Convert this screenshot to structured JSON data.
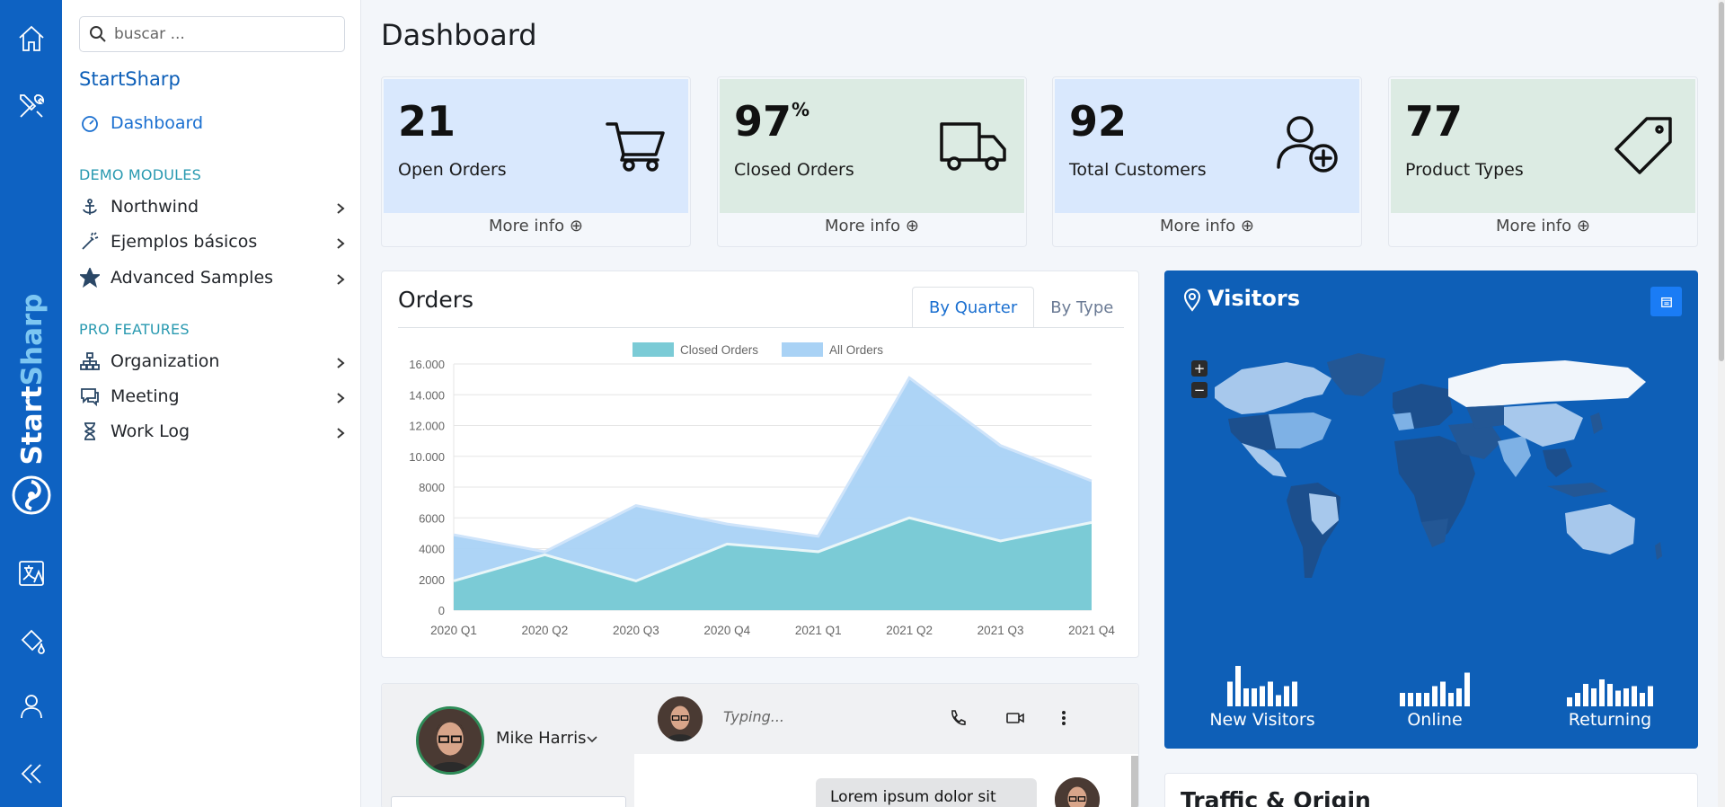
{
  "rail": {
    "items": [
      "home-icon",
      "tools-icon",
      "translate-icon",
      "paint-bucket-icon",
      "user-icon",
      "collapse-icon"
    ],
    "brand_start": "Start",
    "brand_sharp": "Sharp"
  },
  "sidebar": {
    "search_placeholder": "buscar ...",
    "title": "StartSharp",
    "dashboard": "Dashboard",
    "sections": {
      "demo": "DEMO MODULES",
      "pro": "PRO FEATURES"
    },
    "demo_items": [
      {
        "label": "Northwind",
        "icon": "anchor-icon"
      },
      {
        "label": "Ejemplos básicos",
        "icon": "magic-wand-icon"
      },
      {
        "label": "Advanced Samples",
        "icon": "star-icon"
      }
    ],
    "pro_items": [
      {
        "label": "Organization",
        "icon": "org-chart-icon"
      },
      {
        "label": "Meeting",
        "icon": "chat-icon"
      },
      {
        "label": "Work Log",
        "icon": "hourglass-icon"
      }
    ]
  },
  "page": {
    "title": "Dashboard"
  },
  "stats": [
    {
      "value": "21",
      "suffix": "",
      "label": "Open Orders",
      "more": "More info",
      "icon": "cart-icon"
    },
    {
      "value": "97",
      "suffix": "%",
      "label": "Closed Orders",
      "more": "More info",
      "icon": "truck-icon"
    },
    {
      "value": "92",
      "suffix": "",
      "label": "Total Customers",
      "more": "More info",
      "icon": "user-add-icon"
    },
    {
      "value": "77",
      "suffix": "",
      "label": "Product Types",
      "more": "More info",
      "icon": "tag-icon"
    }
  ],
  "orders": {
    "title": "Orders",
    "tabs": [
      "By Quarter",
      "By Type"
    ],
    "active_tab": "By Quarter"
  },
  "chart_data": {
    "type": "area",
    "categories": [
      "2020 Q1",
      "2020 Q2",
      "2020 Q3",
      "2020 Q4",
      "2021 Q1",
      "2021 Q2",
      "2021 Q3",
      "2021 Q4"
    ],
    "series": [
      {
        "name": "Closed Orders",
        "values": [
          1900,
          3600,
          1900,
          4300,
          3800,
          6000,
          4500,
          5700
        ],
        "color": "#7bcbd6"
      },
      {
        "name": "All Orders",
        "values": [
          4900,
          3800,
          6800,
          5600,
          4800,
          15100,
          10700,
          8400
        ],
        "color": "#a9d2f5"
      }
    ],
    "yticks": [
      "0",
      "2000",
      "4000",
      "6000",
      "8000",
      "10.000",
      "12.000",
      "14.000",
      "16.000"
    ],
    "ylim": [
      0,
      16000
    ],
    "legend": "top-center",
    "grid": true
  },
  "visitors": {
    "title": "Visitors",
    "zoom_in": "+",
    "zoom_out": "−",
    "sparklines": [
      {
        "label": "New Visitors",
        "values": [
          55,
          90,
          40,
          40,
          45,
          55,
          25,
          45,
          55
        ]
      },
      {
        "label": "Online",
        "values": [
          30,
          30,
          30,
          30,
          45,
          55,
          30,
          40,
          75
        ]
      },
      {
        "label": "Returning",
        "values": [
          20,
          30,
          50,
          40,
          60,
          50,
          35,
          40,
          45,
          30,
          45
        ]
      }
    ]
  },
  "chat": {
    "user_name": "Mike Harris",
    "typing": "Typing...",
    "message": "Lorem ipsum dolor sit"
  },
  "traffic": {
    "title": "Traffic & Origin"
  }
}
